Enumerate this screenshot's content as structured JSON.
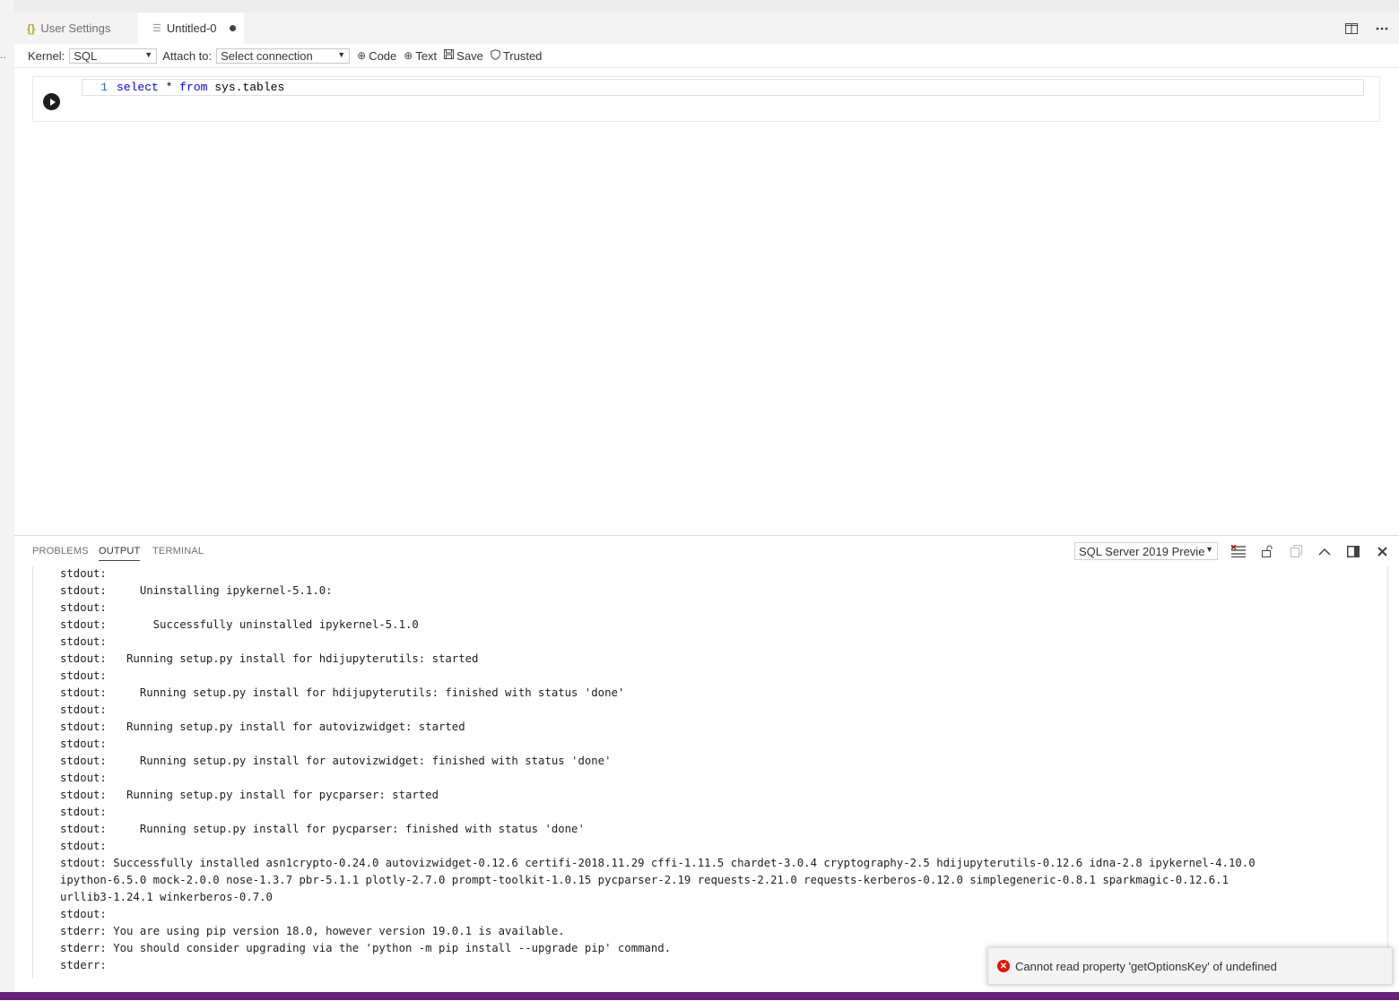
{
  "tabs": [
    {
      "label": "User Settings",
      "icon": "braces-icon"
    },
    {
      "label": "Untitled-0",
      "icon": "notebook-file-icon",
      "dirty": true
    }
  ],
  "toolbar": {
    "kernel_label": "Kernel:",
    "kernel_value": "SQL",
    "attach_label": "Attach to:",
    "attach_value": "Select connection",
    "code_btn": "Code",
    "text_btn": "Text",
    "save_btn": "Save",
    "trusted_btn": "Trusted"
  },
  "cell": {
    "line_number": "1",
    "code_kw1": "select",
    "code_mid": " * ",
    "code_kw2": "from",
    "code_tail": " sys.tables"
  },
  "panel": {
    "tabs": [
      "PROBLEMS",
      "OUTPUT",
      "TERMINAL"
    ],
    "active_tab": "OUTPUT",
    "channel": "SQL Server 2019 Previe",
    "lines": [
      "stdout:",
      "stdout:     Uninstalling ipykernel-5.1.0:",
      "stdout:",
      "stdout:       Successfully uninstalled ipykernel-5.1.0",
      "stdout:",
      "stdout:   Running setup.py install for hdijupyterutils: started",
      "stdout:",
      "stdout:     Running setup.py install for hdijupyterutils: finished with status 'done'",
      "stdout:",
      "stdout:   Running setup.py install for autovizwidget: started",
      "stdout:",
      "stdout:     Running setup.py install for autovizwidget: finished with status 'done'",
      "stdout:",
      "stdout:   Running setup.py install for pycparser: started",
      "stdout:",
      "stdout:     Running setup.py install for pycparser: finished with status 'done'",
      "stdout:",
      "stdout: Successfully installed asn1crypto-0.24.0 autovizwidget-0.12.6 certifi-2018.11.29 cffi-1.11.5 chardet-3.0.4 cryptography-2.5 hdijupyterutils-0.12.6 idna-2.8 ipykernel-4.10.0",
      "ipython-6.5.0 mock-2.0.0 nose-1.3.7 pbr-5.1.1 plotly-2.7.0 prompt-toolkit-1.0.15 pycparser-2.19 requests-2.21.0 requests-kerberos-0.12.0 simplegeneric-0.8.1 sparkmagic-0.12.6.1",
      "urllib3-1.24.1 winkerberos-0.7.0",
      "stdout:",
      "stderr: You are using pip version 18.0, however version 19.0.1 is available.",
      "stderr: You should consider upgrading via the 'python -m pip install --upgrade pip' command.",
      "stderr:"
    ]
  },
  "toast": {
    "message": "Cannot read property 'getOptionsKey' of undefined"
  },
  "colors": {
    "statusbar": "#68217a",
    "error": "#e51400",
    "keyword": "#0000ff"
  }
}
